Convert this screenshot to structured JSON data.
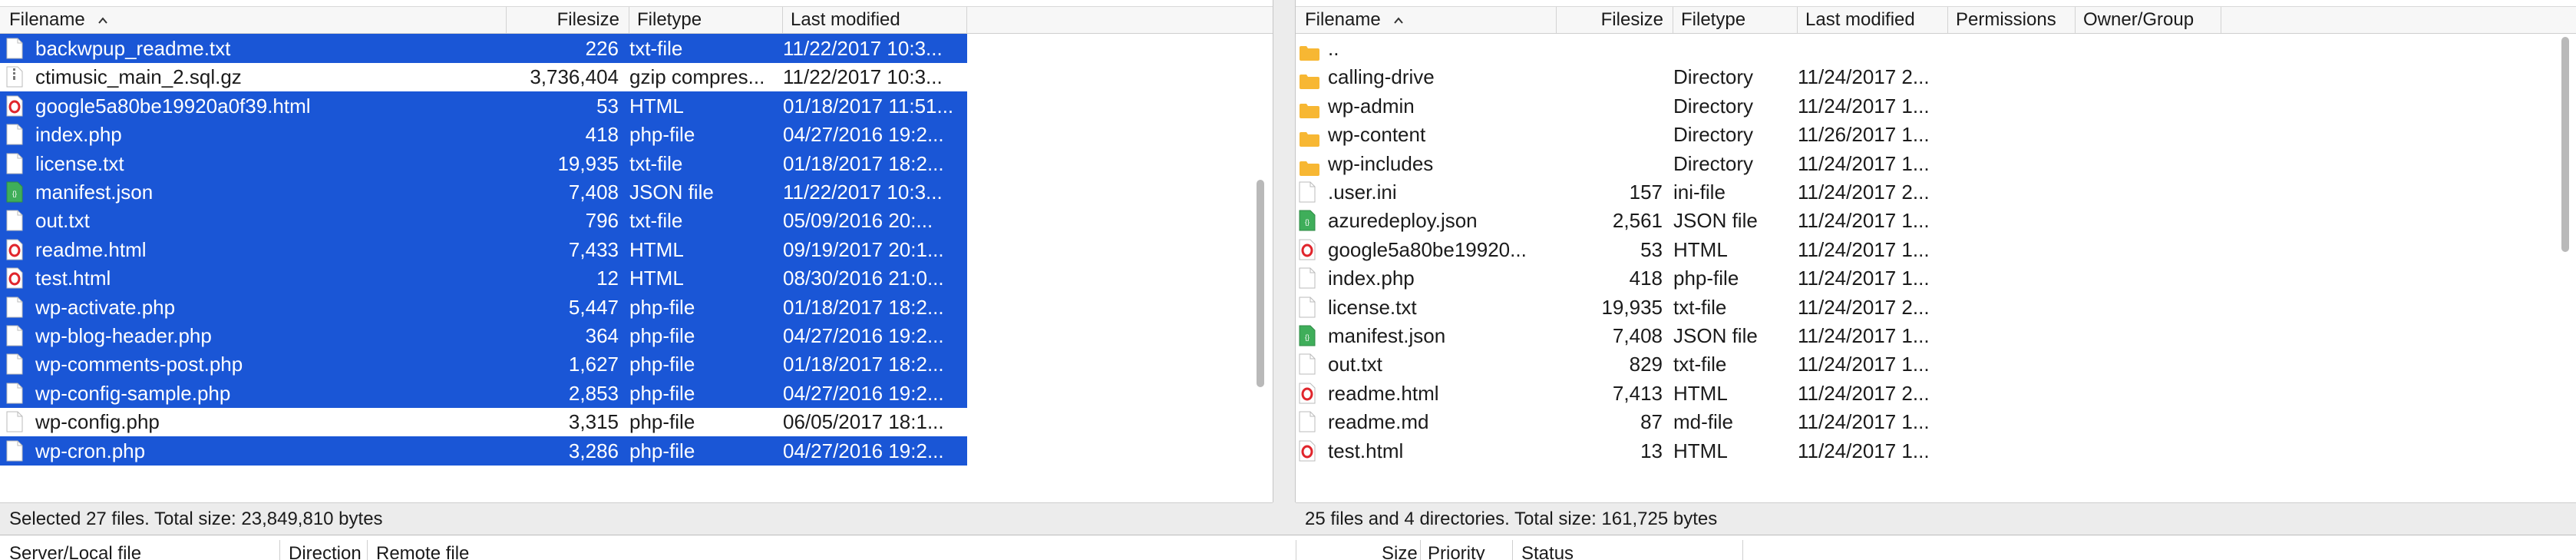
{
  "left": {
    "columns": {
      "filename": "Filename",
      "filesize": "Filesize",
      "filetype": "Filetype",
      "modified": "Last modified"
    },
    "rows": [
      {
        "name": "backwpup_readme.txt",
        "size": "226",
        "type": "txt-file",
        "modified": "11/22/2017 10:3...",
        "selected": true,
        "icon": "text-file-icon"
      },
      {
        "name": "ctimusic_main_2.sql.gz",
        "size": "3,736,404",
        "type": "gzip compres...",
        "modified": "11/22/2017 10:3...",
        "selected": false,
        "icon": "archive-file-icon"
      },
      {
        "name": "google5a80be19920a0f39.html",
        "size": "53",
        "type": "HTML",
        "modified": "01/18/2017 11:51...",
        "selected": true,
        "icon": "opera-html-icon"
      },
      {
        "name": "index.php",
        "size": "418",
        "type": "php-file",
        "modified": "04/27/2016 19:2...",
        "selected": true,
        "icon": "text-file-icon"
      },
      {
        "name": "license.txt",
        "size": "19,935",
        "type": "txt-file",
        "modified": "01/18/2017 18:2...",
        "selected": true,
        "icon": "text-file-icon"
      },
      {
        "name": "manifest.json",
        "size": "7,408",
        "type": "JSON file",
        "modified": "11/22/2017 10:3...",
        "selected": true,
        "icon": "json-file-icon"
      },
      {
        "name": "out.txt",
        "size": "796",
        "type": "txt-file",
        "modified": "05/09/2016 20:...",
        "selected": true,
        "icon": "text-file-icon"
      },
      {
        "name": "readme.html",
        "size": "7,433",
        "type": "HTML",
        "modified": "09/19/2017 20:1...",
        "selected": true,
        "icon": "opera-html-icon"
      },
      {
        "name": "test.html",
        "size": "12",
        "type": "HTML",
        "modified": "08/30/2016 21:0...",
        "selected": true,
        "icon": "opera-html-icon"
      },
      {
        "name": "wp-activate.php",
        "size": "5,447",
        "type": "php-file",
        "modified": "01/18/2017 18:2...",
        "selected": true,
        "icon": "text-file-icon"
      },
      {
        "name": "wp-blog-header.php",
        "size": "364",
        "type": "php-file",
        "modified": "04/27/2016 19:2...",
        "selected": true,
        "icon": "text-file-icon"
      },
      {
        "name": "wp-comments-post.php",
        "size": "1,627",
        "type": "php-file",
        "modified": "01/18/2017 18:2...",
        "selected": true,
        "icon": "text-file-icon"
      },
      {
        "name": "wp-config-sample.php",
        "size": "2,853",
        "type": "php-file",
        "modified": "04/27/2016 19:2...",
        "selected": true,
        "icon": "text-file-icon"
      },
      {
        "name": "wp-config.php",
        "size": "3,315",
        "type": "php-file",
        "modified": "06/05/2017 18:1...",
        "selected": false,
        "icon": "text-file-icon"
      },
      {
        "name": "wp-cron.php",
        "size": "3,286",
        "type": "php-file",
        "modified": "04/27/2016 19:2...",
        "selected": true,
        "icon": "text-file-icon"
      }
    ],
    "status": "Selected 27 files. Total size: 23,849,810 bytes"
  },
  "right": {
    "columns": {
      "filename": "Filename",
      "filesize": "Filesize",
      "filetype": "Filetype",
      "modified": "Last modified",
      "permissions": "Permissions",
      "owner": "Owner/Group"
    },
    "rows": [
      {
        "name": "..",
        "size": "",
        "type": "",
        "modified": "",
        "icon": "folder-icon"
      },
      {
        "name": "calling-drive",
        "size": "",
        "type": "Directory",
        "modified": "11/24/2017 2...",
        "icon": "folder-icon"
      },
      {
        "name": "wp-admin",
        "size": "",
        "type": "Directory",
        "modified": "11/24/2017 1...",
        "icon": "folder-icon"
      },
      {
        "name": "wp-content",
        "size": "",
        "type": "Directory",
        "modified": "11/26/2017 1...",
        "icon": "folder-icon"
      },
      {
        "name": "wp-includes",
        "size": "",
        "type": "Directory",
        "modified": "11/24/2017 1...",
        "icon": "folder-icon"
      },
      {
        "name": ".user.ini",
        "size": "157",
        "type": "ini-file",
        "modified": "11/24/2017 2...",
        "icon": "text-file-icon"
      },
      {
        "name": "azuredeploy.json",
        "size": "2,561",
        "type": "JSON file",
        "modified": "11/24/2017 1...",
        "icon": "json-file-icon"
      },
      {
        "name": "google5a80be19920...",
        "size": "53",
        "type": "HTML",
        "modified": "11/24/2017 1...",
        "icon": "opera-html-icon"
      },
      {
        "name": "index.php",
        "size": "418",
        "type": "php-file",
        "modified": "11/24/2017 1...",
        "icon": "text-file-icon"
      },
      {
        "name": "license.txt",
        "size": "19,935",
        "type": "txt-file",
        "modified": "11/24/2017 2...",
        "icon": "text-file-icon"
      },
      {
        "name": "manifest.json",
        "size": "7,408",
        "type": "JSON file",
        "modified": "11/24/2017 1...",
        "icon": "json-file-icon"
      },
      {
        "name": "out.txt",
        "size": "829",
        "type": "txt-file",
        "modified": "11/24/2017 1...",
        "icon": "text-file-icon"
      },
      {
        "name": "readme.html",
        "size": "7,413",
        "type": "HTML",
        "modified": "11/24/2017 2...",
        "icon": "opera-html-icon"
      },
      {
        "name": "readme.md",
        "size": "87",
        "type": "md-file",
        "modified": "11/24/2017 1...",
        "icon": "text-file-icon"
      },
      {
        "name": "test.html",
        "size": "13",
        "type": "HTML",
        "modified": "11/24/2017 1...",
        "icon": "opera-html-icon"
      }
    ],
    "status": "25 files and 4 directories. Total size: 161,725 bytes"
  },
  "queue": {
    "server_local_file": "Server/Local file",
    "direction": "Direction",
    "remote_file": "Remote file",
    "size": "Size",
    "priority": "Priority",
    "status": "Status"
  },
  "colors": {
    "selection": "#1a56d6",
    "folder": "#f7b733",
    "json": "#3fae5a",
    "opera": "#e0252c"
  }
}
